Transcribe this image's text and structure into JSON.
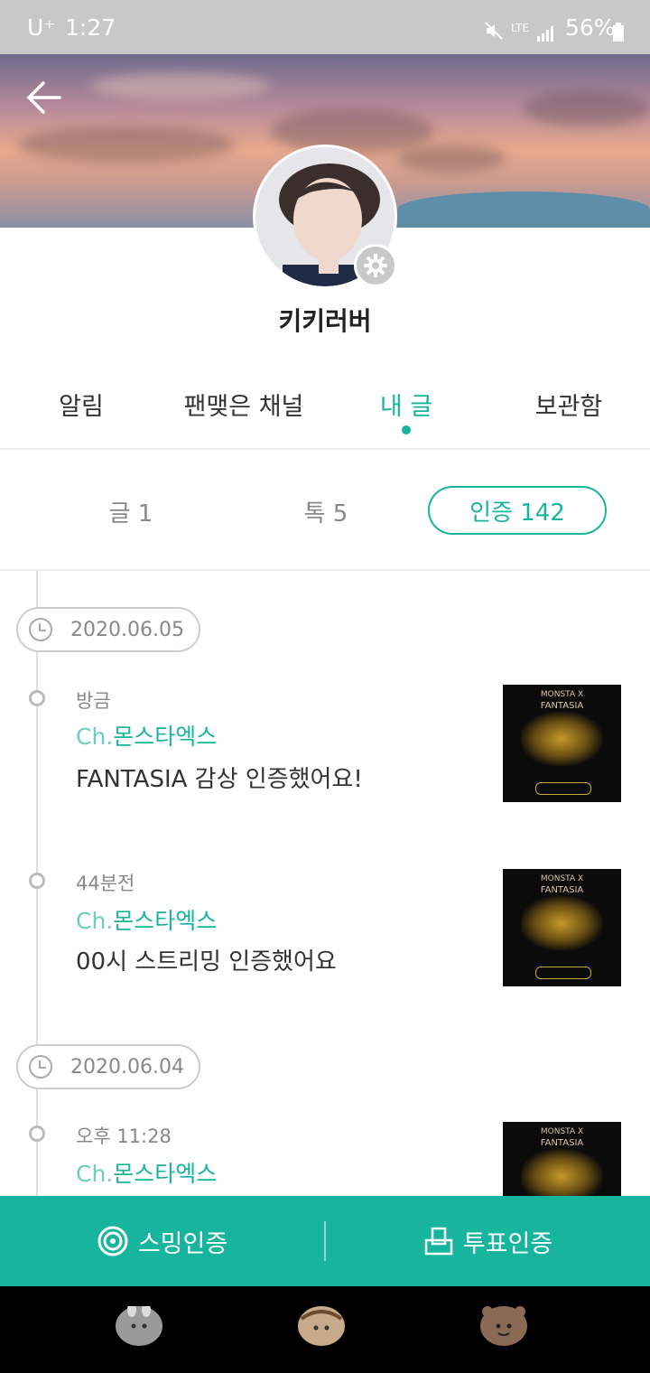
{
  "status_bar": {
    "carrier": "U⁺",
    "time": "1:27",
    "network": "LTE",
    "battery": "56%"
  },
  "profile": {
    "username": "키키러버"
  },
  "tabs": [
    {
      "label": "알림"
    },
    {
      "label": "팬맺은 채널"
    },
    {
      "label": "내 글"
    },
    {
      "label": "보관함"
    }
  ],
  "sub_tabs": {
    "posts": "글 1",
    "talks": "톡 5",
    "certifications": "인증 142"
  },
  "timeline": [
    {
      "date": "2020.06.05",
      "items": [
        {
          "time": "방금",
          "channel_prefix": "Ch.",
          "channel_name": "몬스타엑스",
          "message": "FANTASIA 감상 인증했어요!"
        },
        {
          "time": "44분전",
          "channel_prefix": "Ch.",
          "channel_name": "몬스타엑스",
          "message": "00시 스트리밍 인증했어요"
        }
      ]
    },
    {
      "date": "2020.06.04",
      "items": [
        {
          "time": "오후 11:28",
          "channel_prefix": "Ch.",
          "channel_name": "몬스타엑스",
          "message": ""
        }
      ]
    }
  ],
  "thumbnail": {
    "title": "FANTASIA",
    "top_text": "MONSTA X"
  },
  "actions": {
    "streaming": "스밍인증",
    "voting": "투표인증"
  },
  "colors": {
    "accent": "#17b59e"
  },
  "icons": {
    "back": "back-arrow-icon",
    "settings": "gear-icon",
    "clock": "clock-icon",
    "streaming": "disc-icon",
    "voting": "ballot-box-icon"
  }
}
